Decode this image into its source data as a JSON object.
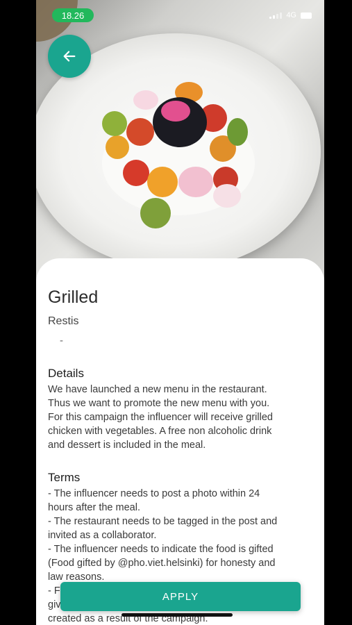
{
  "status_bar": {
    "time": "18.26",
    "network": "4G"
  },
  "header": {
    "back_icon": "arrow-left-icon"
  },
  "offer": {
    "title": "Grilled",
    "restaurant": "Restis",
    "separator": "-"
  },
  "details": {
    "heading": "Details",
    "lines": [
      "We have launched a new menu in the restaurant.",
      "Thus we want to promote the new menu with you.",
      "For this campaign the influencer will receive grilled",
      "chicken with vegetables. A free non alcoholic drink",
      "and dessert is included in the meal."
    ]
  },
  "terms": {
    "heading": "Terms",
    "lines": [
      "- The influencer needs to post a photo within 24",
      "hours after the meal.",
      "- The restaurant needs to be tagged in the post and",
      "invited as a collaborator.",
      "- The influencer needs to indicate the food is gifted",
      "(Food gifted by @pho.viet.helsinki) for honesty and",
      "law reasons.",
      "- F",
      "giv",
      "created as a result of the campaign."
    ]
  },
  "actions": {
    "apply_label": "APPLY"
  },
  "colors": {
    "accent": "#1aa58f",
    "time_pill": "#22b85c"
  }
}
